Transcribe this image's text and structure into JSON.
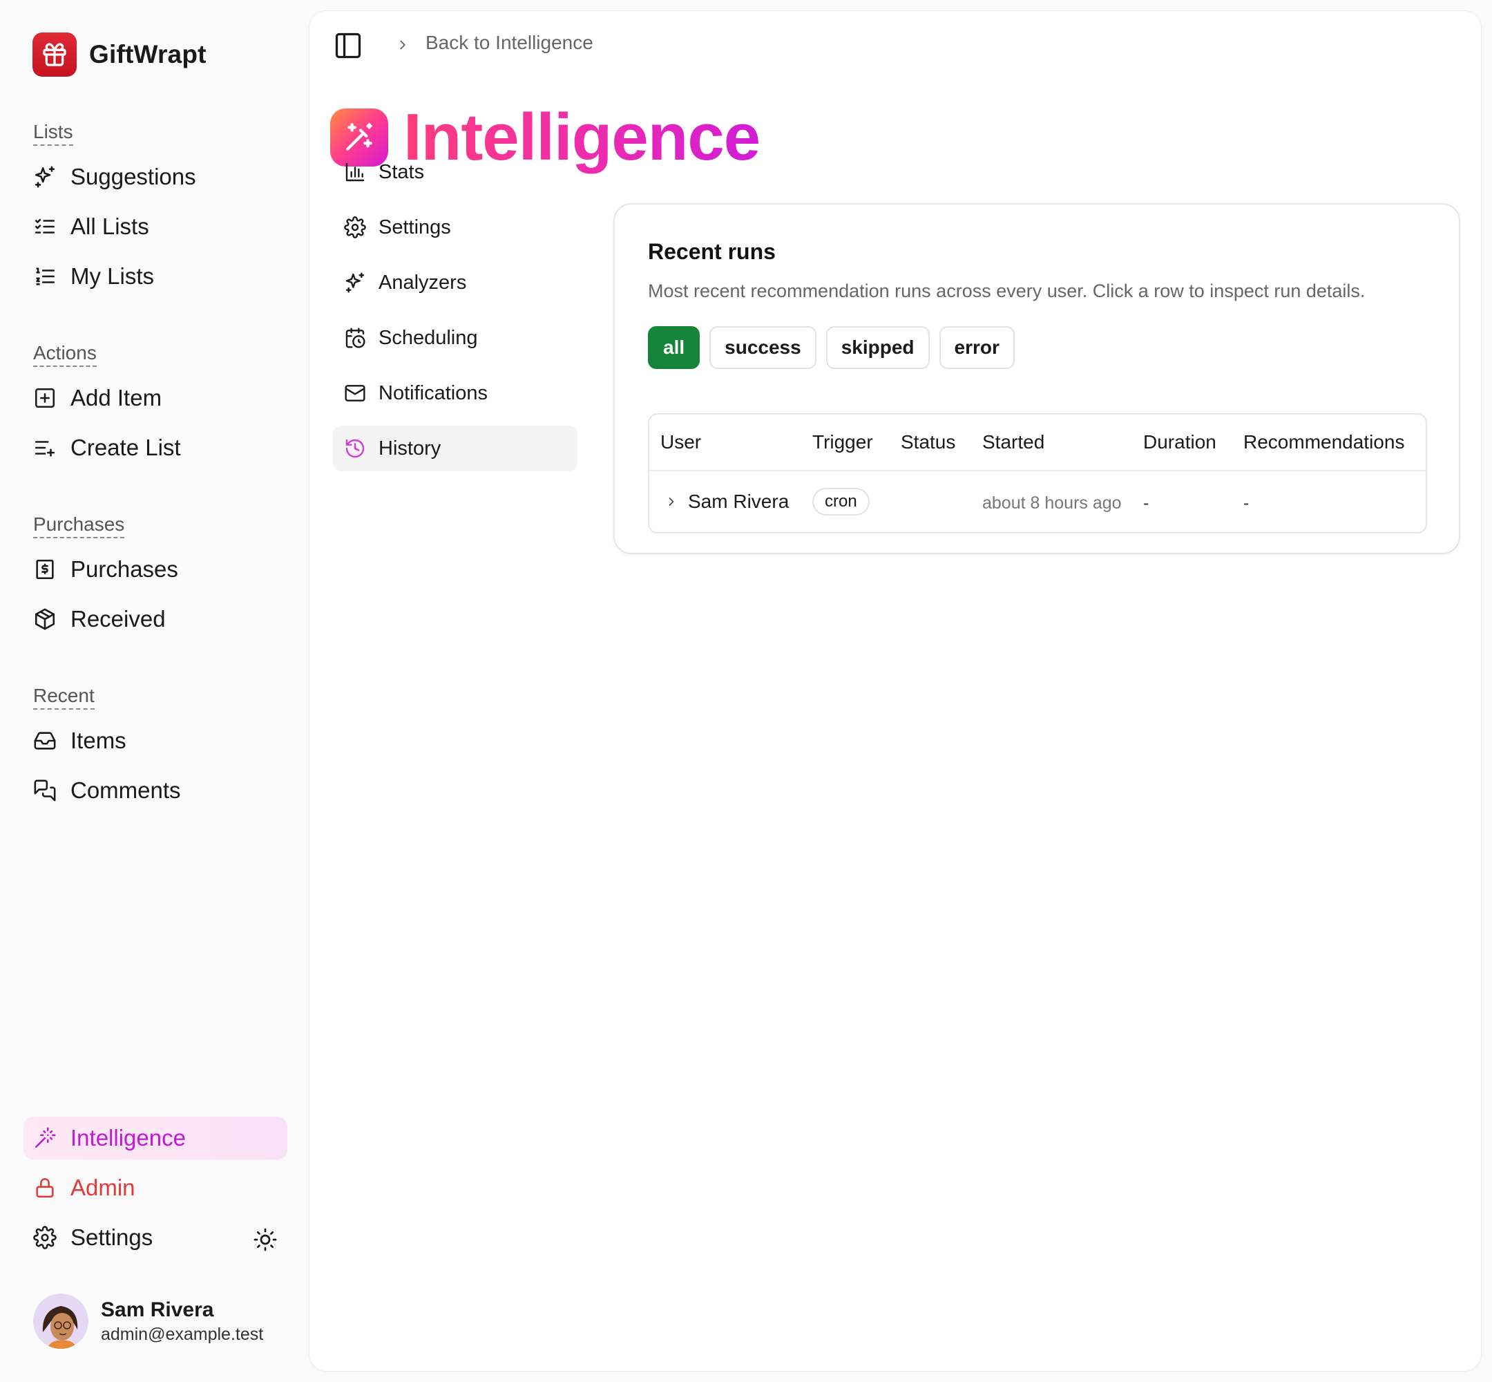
{
  "app": {
    "name": "GiftWrapt"
  },
  "sidebar": {
    "sections": [
      {
        "title": "Lists",
        "items": [
          {
            "label": "Suggestions",
            "icon": "sparkles-icon"
          },
          {
            "label": "All Lists",
            "icon": "list-checks-icon"
          },
          {
            "label": "My Lists",
            "icon": "list-ordered-icon"
          }
        ]
      },
      {
        "title": "Actions",
        "items": [
          {
            "label": "Add Item",
            "icon": "square-plus-icon"
          },
          {
            "label": "Create List",
            "icon": "list-plus-icon"
          }
        ]
      },
      {
        "title": "Purchases",
        "items": [
          {
            "label": "Purchases",
            "icon": "receipt-icon"
          },
          {
            "label": "Received",
            "icon": "package-open-icon"
          }
        ]
      },
      {
        "title": "Recent",
        "items": [
          {
            "label": "Items",
            "icon": "inbox-icon"
          },
          {
            "label": "Comments",
            "icon": "messages-icon"
          }
        ]
      }
    ],
    "bottom": [
      {
        "label": "Intelligence",
        "icon": "wand-icon",
        "active": true
      },
      {
        "label": "Admin",
        "icon": "lock-icon"
      },
      {
        "label": "Settings",
        "icon": "gear-icon"
      }
    ],
    "user": {
      "name": "Sam Rivera",
      "email": "admin@example.test"
    }
  },
  "breadcrumb": {
    "back_label": "Back to Intelligence"
  },
  "page": {
    "title": "Intelligence"
  },
  "subnav": [
    {
      "label": "Stats",
      "icon": "bar-chart-icon"
    },
    {
      "label": "Settings",
      "icon": "gear-icon"
    },
    {
      "label": "Analyzers",
      "icon": "sparkles-icon"
    },
    {
      "label": "Scheduling",
      "icon": "calendar-clock-icon"
    },
    {
      "label": "Notifications",
      "icon": "mail-icon"
    },
    {
      "label": "History",
      "icon": "history-icon",
      "active": true
    }
  ],
  "runs": {
    "title": "Recent runs",
    "description": "Most recent recommendation runs across every user. Click a row to inspect run details.",
    "filters": [
      "all",
      "success",
      "skipped",
      "error"
    ],
    "active_filter": "all",
    "columns": [
      "User",
      "Trigger",
      "Status",
      "Started",
      "Duration",
      "Recommendations"
    ],
    "rows": [
      {
        "user": "Sam Rivera",
        "trigger": "cron",
        "status": "",
        "started": "about 8 hours ago",
        "duration": "-",
        "recommendations": "-"
      }
    ]
  },
  "colors": {
    "brand_red": "#d51d29",
    "accent_pink": "#e62bb4",
    "accent_purple": "#c01ad2",
    "active_filter": "#16853a",
    "admin_red": "#e23a3a"
  }
}
